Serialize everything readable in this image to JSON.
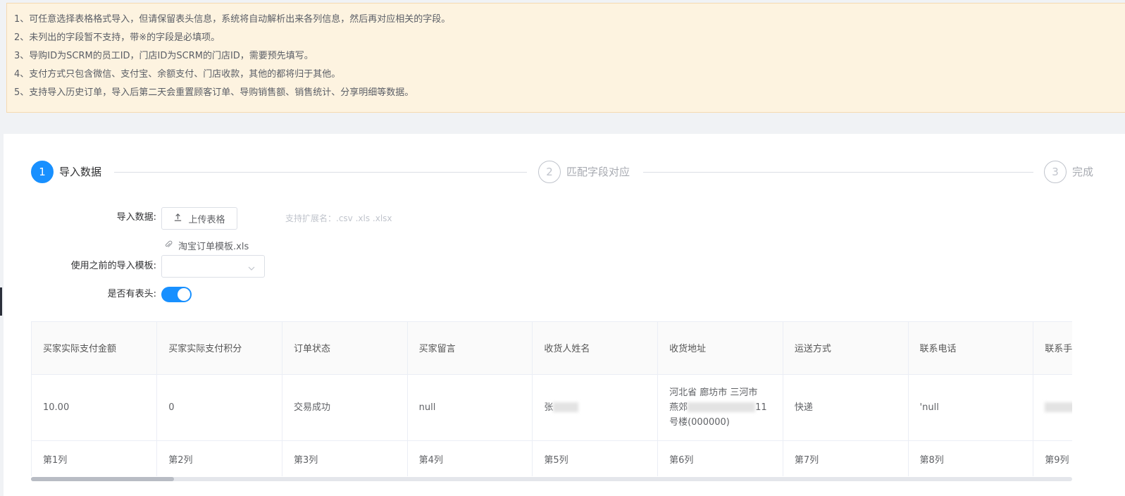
{
  "notice": [
    "1、可任意选择表格格式导入，但请保留表头信息，系统将自动解析出来各列信息，然后再对应相关的字段。",
    "2、未列出的字段暂不支持，带※的字段是必填项。",
    "3、导购ID为SCRM的员工ID，门店ID为SCRM的门店ID，需要预先填写。",
    "4、支付方式只包含微信、支付宝、余额支付、门店收款，其他的都将归于其他。",
    "5、支持导入历史订单，导入后第二天会重置顾客订单、导购销售额、销售统计、分享明细等数据。"
  ],
  "steps": [
    {
      "num": "1",
      "label": "导入数据"
    },
    {
      "num": "2",
      "label": "匹配字段对应"
    },
    {
      "num": "3",
      "label": "完成"
    }
  ],
  "form": {
    "import_label": "导入数据:",
    "upload_button": "上传表格",
    "hint": "支持扩展名：.csv .xls .xlsx",
    "file_name": "淘宝订单模板.xls",
    "template_label": "使用之前的导入模板:",
    "template_value": "",
    "header_label": "是否有表头:",
    "header_on": true
  },
  "table": {
    "headers": [
      "买家实际支付金额",
      "买家实际支付积分",
      "订单状态",
      "买家留言",
      "收货人姓名",
      "收货地址",
      "运送方式",
      "联系电话",
      "联系手机"
    ],
    "row": {
      "amount": "10.00",
      "points": "0",
      "status": "交易成功",
      "message": "null",
      "name_prefix": "张",
      "address_line1": "河北省 廊坊市 三河市",
      "address_line2_prefix": "燕郊",
      "address_line2_suffix": "11",
      "address_line3": "号楼(000000)",
      "shipping": "快递",
      "phone": "'null",
      "mobile": ""
    },
    "column_labels": [
      "第1列",
      "第2列",
      "第3列",
      "第4列",
      "第5列",
      "第6列",
      "第7列",
      "第8列",
      "第9列"
    ],
    "scroll_position_fraction": 0
  },
  "colors": {
    "primary": "#1890ff",
    "notice_bg": "#fdf3e0",
    "page_bg": "#f0f2f5"
  }
}
